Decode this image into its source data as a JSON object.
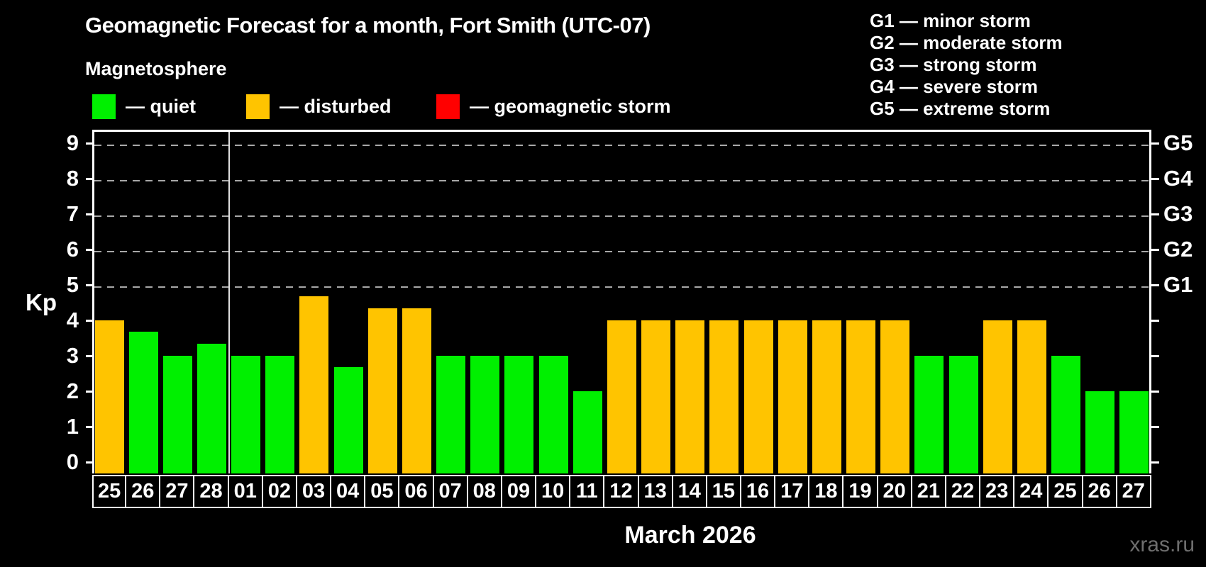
{
  "title": "Geomagnetic Forecast for a month, Fort Smith (UTC-07)",
  "subtitle": "Magnetosphere",
  "legend": {
    "items": [
      {
        "key": "quiet",
        "label": "— quiet",
        "color": "#00f000",
        "x": 130
      },
      {
        "key": "disturbed",
        "label": "— disturbed",
        "color": "#ffc400",
        "x": 347
      },
      {
        "key": "storm",
        "label": "— geomagnetic storm",
        "color": "#ff0000",
        "x": 615
      }
    ]
  },
  "storm_scale_legend": [
    "G1 — minor storm",
    "G2 — moderate storm",
    "G3 — strong storm",
    "G4 — severe storm",
    "G5 — extreme storm"
  ],
  "watermark": "xras.ru",
  "chart_data": {
    "type": "bar",
    "title": "Geomagnetic Forecast for a month, Fort Smith (UTC-07)",
    "ylabel": "Kp",
    "xlabel": "March 2026",
    "ylim": [
      0,
      9
    ],
    "grid": "horizontal dashed lines at G-storm levels only",
    "legend_position": "top-left",
    "categories": [
      "25",
      "26",
      "27",
      "28",
      "01",
      "02",
      "03",
      "04",
      "05",
      "06",
      "07",
      "08",
      "09",
      "10",
      "11",
      "12",
      "13",
      "14",
      "15",
      "16",
      "17",
      "18",
      "19",
      "20",
      "21",
      "22",
      "23",
      "24",
      "25",
      "26",
      "27"
    ],
    "values": [
      4.0,
      3.67,
      3.0,
      3.33,
      3.0,
      3.0,
      4.67,
      2.67,
      4.33,
      4.33,
      3.0,
      3.0,
      3.0,
      3.0,
      2.0,
      4.0,
      4.0,
      4.0,
      4.0,
      4.0,
      4.0,
      4.0,
      4.0,
      4.0,
      3.0,
      3.0,
      4.0,
      4.0,
      3.0,
      2.0,
      2.0
    ],
    "statuses": [
      "disturbed",
      "quiet",
      "quiet",
      "quiet",
      "quiet",
      "quiet",
      "disturbed",
      "quiet",
      "disturbed",
      "disturbed",
      "quiet",
      "quiet",
      "quiet",
      "quiet",
      "quiet",
      "disturbed",
      "disturbed",
      "disturbed",
      "disturbed",
      "disturbed",
      "disturbed",
      "disturbed",
      "disturbed",
      "disturbed",
      "quiet",
      "quiet",
      "disturbed",
      "disturbed",
      "quiet",
      "quiet",
      "quiet"
    ],
    "status_colors": {
      "quiet": "#00f000",
      "disturbed": "#ffc400",
      "storm": "#ff0000"
    },
    "y_ticks": [
      "0",
      "1",
      "2",
      "3",
      "4",
      "5",
      "6",
      "7",
      "8",
      "9"
    ],
    "gridlines_kp": [
      5,
      6,
      7,
      8,
      9
    ],
    "right_axis_ticks_kp": [
      0,
      1,
      2,
      3,
      4,
      5,
      6,
      7,
      8,
      9
    ],
    "right_axis_labels": [
      {
        "kp": 5,
        "label": "G1"
      },
      {
        "kp": 6,
        "label": "G2"
      },
      {
        "kp": 7,
        "label": "G3"
      },
      {
        "kp": 8,
        "label": "G4"
      },
      {
        "kp": 9,
        "label": "G5"
      }
    ],
    "month_separator_after_index": 3
  }
}
